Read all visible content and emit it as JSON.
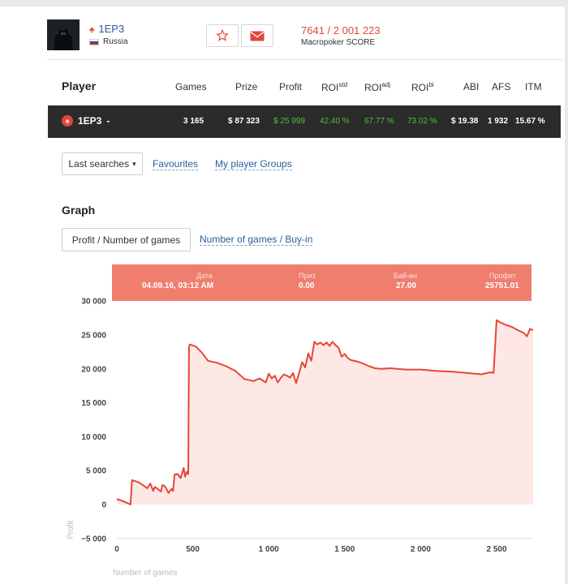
{
  "player": {
    "name": "1EP3",
    "country": "Russia",
    "score": "7641 / 2 001 223",
    "score_label": "Macropoker SCORE"
  },
  "icons": {
    "suit": "poker-spade-icon",
    "favorite": "star-icon",
    "message": "envelope-icon",
    "flag": "russia-flag-icon"
  },
  "colors": {
    "accent": "#e3473b",
    "link": "#2a5d9a",
    "positive": "#4fbf3a",
    "row_bg": "#2b2b2b",
    "tooltip_bg": "#f07e6f",
    "line": "#e5473a",
    "area": "#fde8e6"
  },
  "table": {
    "headers": {
      "player": "Player",
      "games": "Games",
      "prize": "Prize",
      "profit": "Profit",
      "roi_std": "ROI",
      "roi_std_sup": "std",
      "roi_adj": "ROI",
      "roi_adj_sup": "adj",
      "roi_bi": "ROI",
      "roi_bi_sup": "bi",
      "abi": "ABI",
      "afs": "AFS",
      "itm": "ITM"
    },
    "row": {
      "player": "1EP3",
      "dropdown": "-",
      "games": "3 165",
      "prize": "$ 87 323",
      "profit": "$ 25 999",
      "roi_std": "42.40 %",
      "roi_adj": "67.77 %",
      "roi_bi": "73.02 %",
      "abi": "$ 19.38",
      "afs": "1 932",
      "itm": "15.67 %"
    }
  },
  "search": {
    "last_searches": "Last searches",
    "caret": "▾",
    "favourites": "Favourites",
    "groups": "My player Groups"
  },
  "graph": {
    "title": "Graph",
    "tab_active": "Profit / Number of games",
    "tab_other": "Number of games / Buy-in"
  },
  "tooltip": {
    "date_label": "Дата",
    "date_value": "04.09.16, 03:12 AM",
    "prize_label": "Приз",
    "prize_value": "0.00",
    "buyin_label": "Бай-ин",
    "buyin_value": "27.00",
    "profit_label": "Профит",
    "profit_value": "25751.01"
  },
  "chart_data": {
    "type": "area",
    "xlabel": "Number of games",
    "ylabel": "Profit",
    "xlim": [
      0,
      2760
    ],
    "ylim": [
      -5000,
      30000
    ],
    "y_ticks": [
      30000,
      25000,
      20000,
      15000,
      10000,
      5000,
      0,
      -5000
    ],
    "y_tick_labels": [
      "30 000",
      "25 000",
      "20 000",
      "15 000",
      "10 000",
      "5 000",
      "0",
      "−5 000"
    ],
    "x_ticks": [
      0,
      500,
      1000,
      1500,
      2000,
      2500
    ],
    "x_tick_labels": [
      "0",
      "500",
      "1 000",
      "1 500",
      "2 000",
      "2 500"
    ],
    "series": [
      {
        "x": [
          0,
          40,
          70,
          90,
          100,
          140,
          170,
          200,
          220,
          240,
          250,
          270,
          290,
          300,
          320,
          340,
          360,
          370,
          380,
          400,
          420,
          440,
          450,
          460,
          470,
          475,
          480,
          520,
          560,
          600,
          660,
          720,
          780,
          840,
          900,
          940,
          980,
          1000,
          1020,
          1040,
          1060,
          1080,
          1100,
          1120,
          1140,
          1160,
          1180,
          1200,
          1220,
          1240,
          1260,
          1280,
          1300,
          1320,
          1340,
          1360,
          1380,
          1400,
          1420,
          1440,
          1460,
          1480,
          1500,
          1520,
          1540,
          1580,
          1620,
          1660,
          1700,
          1740,
          1800,
          1900,
          2000,
          2100,
          2200,
          2300,
          2400,
          2460,
          2480,
          2500,
          2520,
          2560,
          2600,
          2640,
          2680,
          2700,
          2720,
          2740
        ],
        "y": [
          800,
          500,
          200,
          0,
          3600,
          3300,
          2900,
          2400,
          3100,
          2000,
          2600,
          2300,
          1900,
          2900,
          2600,
          1700,
          2300,
          2000,
          4400,
          4500,
          3900,
          5400,
          4100,
          4800,
          4500,
          23300,
          23600,
          23300,
          22400,
          21200,
          20900,
          20400,
          19700,
          18500,
          18200,
          18600,
          18000,
          19300,
          18600,
          19000,
          18000,
          18700,
          19200,
          19000,
          18700,
          19400,
          17900,
          19400,
          21000,
          20200,
          22300,
          21200,
          24000,
          23600,
          23900,
          23500,
          23900,
          23400,
          24000,
          23500,
          23100,
          21800,
          22200,
          21600,
          21300,
          21100,
          20800,
          20400,
          20100,
          20000,
          20100,
          19900,
          19900,
          19700,
          19600,
          19400,
          19200,
          19500,
          19400,
          27200,
          26900,
          26500,
          26200,
          25700,
          25300,
          24800,
          25900,
          25700
        ]
      }
    ]
  }
}
